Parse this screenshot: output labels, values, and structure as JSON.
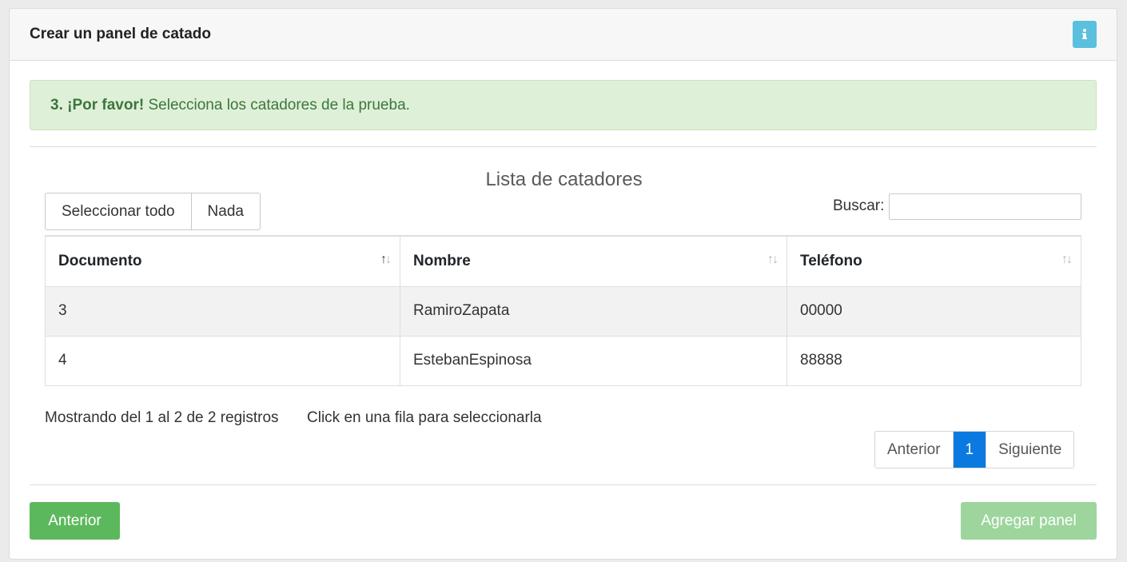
{
  "header": {
    "title": "Crear un panel de catado",
    "info_icon": "info-icon"
  },
  "alert": {
    "strong": "3. ¡Por favor!",
    "text": " Selecciona los catadores de la prueba."
  },
  "list": {
    "title": "Lista de catadores"
  },
  "select_buttons": {
    "all": "Seleccionar todo",
    "none": "Nada"
  },
  "search": {
    "label": "Buscar:",
    "value": ""
  },
  "table": {
    "columns": [
      "Documento",
      "Nombre",
      "Teléfono"
    ],
    "rows": [
      [
        "3",
        "RamiroZapata",
        "00000"
      ],
      [
        "4",
        "EstebanEspinosa",
        "88888"
      ]
    ]
  },
  "footer_info": {
    "showing": "Mostrando del 1 al 2 de 2 registros",
    "hint": "Click en una fila para seleccionarla"
  },
  "pagination": {
    "prev": "Anterior",
    "current": "1",
    "next": "Siguiente"
  },
  "actions": {
    "back": "Anterior",
    "add": "Agregar panel"
  },
  "colors": {
    "success": "#5cb85c",
    "success_disabled": "#9dd59d",
    "info": "#5bc0de",
    "primary": "#0b7ae0",
    "alert_bg": "#dff0d8",
    "alert_text": "#3c763d"
  }
}
